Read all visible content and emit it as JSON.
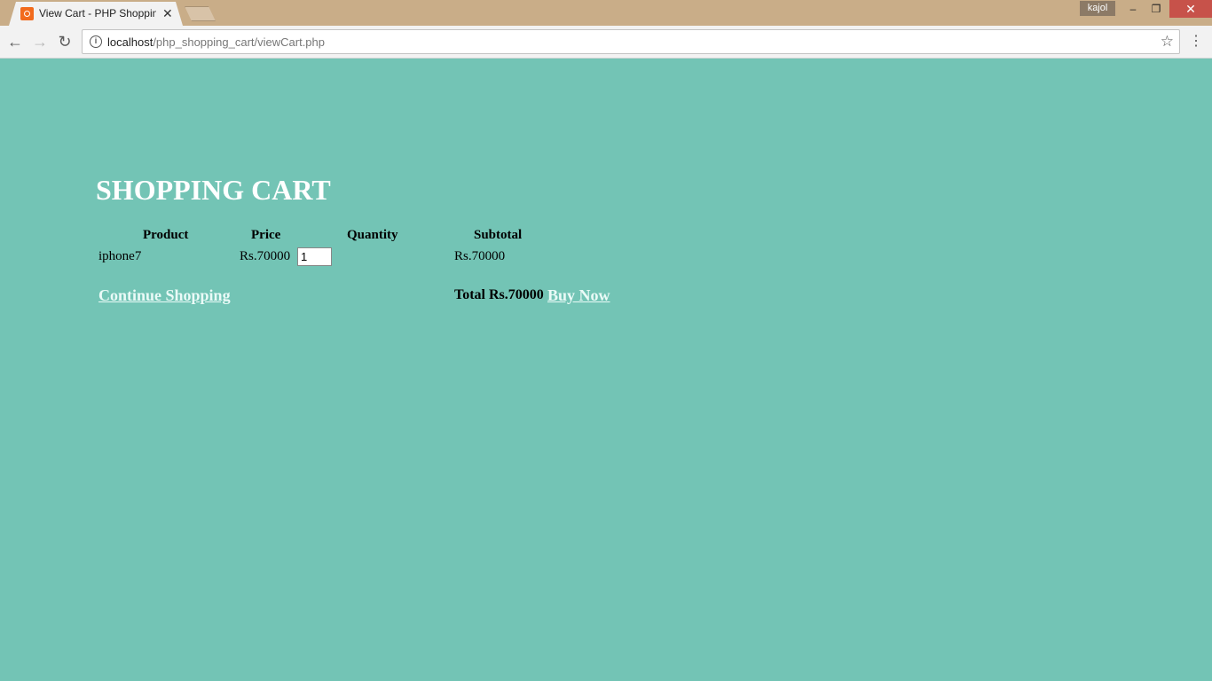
{
  "browser": {
    "tab_title": "View Cart - PHP Shoppin",
    "profile_name": "kajol",
    "url_host": "localhost",
    "url_path": "/php_shopping_cart/viewCart.php"
  },
  "cart": {
    "heading": "SHOPPING CART",
    "columns": [
      "Product",
      "Price",
      "Quantity",
      "Subtotal"
    ],
    "rows": [
      {
        "product": "iphone7",
        "price": "Rs.70000",
        "quantity": "1",
        "subtotal": "Rs.70000"
      }
    ],
    "continue_label": "Continue Shopping",
    "total_label": "Total Rs.70000",
    "buy_label": "Buy Now"
  },
  "colors": {
    "page_background": "#73c4b5",
    "heading_text": "#ffffff",
    "link_text": "#eafaf7"
  }
}
